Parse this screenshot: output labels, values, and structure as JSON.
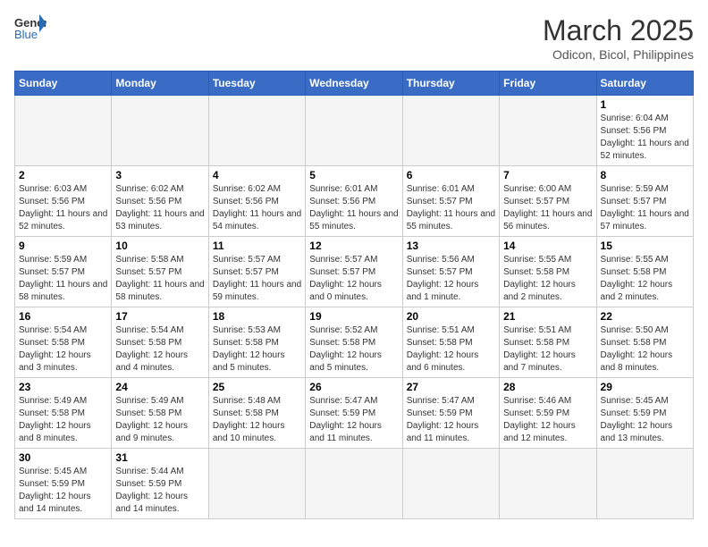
{
  "header": {
    "logo_general": "General",
    "logo_blue": "Blue",
    "month_year": "March 2025",
    "location": "Odicon, Bicol, Philippines"
  },
  "weekdays": [
    "Sunday",
    "Monday",
    "Tuesday",
    "Wednesday",
    "Thursday",
    "Friday",
    "Saturday"
  ],
  "weeks": [
    [
      {
        "day": "",
        "empty": true
      },
      {
        "day": "",
        "empty": true
      },
      {
        "day": "",
        "empty": true
      },
      {
        "day": "",
        "empty": true
      },
      {
        "day": "",
        "empty": true
      },
      {
        "day": "",
        "empty": true
      },
      {
        "day": "1",
        "sunrise": "6:04 AM",
        "sunset": "5:56 PM",
        "daylight": "11 hours and 52 minutes."
      }
    ],
    [
      {
        "day": "2",
        "sunrise": "6:03 AM",
        "sunset": "5:56 PM",
        "daylight": "11 hours and 52 minutes."
      },
      {
        "day": "3",
        "sunrise": "6:02 AM",
        "sunset": "5:56 PM",
        "daylight": "11 hours and 53 minutes."
      },
      {
        "day": "4",
        "sunrise": "6:02 AM",
        "sunset": "5:56 PM",
        "daylight": "11 hours and 54 minutes."
      },
      {
        "day": "5",
        "sunrise": "6:01 AM",
        "sunset": "5:56 PM",
        "daylight": "11 hours and 55 minutes."
      },
      {
        "day": "6",
        "sunrise": "6:01 AM",
        "sunset": "5:57 PM",
        "daylight": "11 hours and 55 minutes."
      },
      {
        "day": "7",
        "sunrise": "6:00 AM",
        "sunset": "5:57 PM",
        "daylight": "11 hours and 56 minutes."
      },
      {
        "day": "8",
        "sunrise": "5:59 AM",
        "sunset": "5:57 PM",
        "daylight": "11 hours and 57 minutes."
      }
    ],
    [
      {
        "day": "9",
        "sunrise": "5:59 AM",
        "sunset": "5:57 PM",
        "daylight": "11 hours and 58 minutes."
      },
      {
        "day": "10",
        "sunrise": "5:58 AM",
        "sunset": "5:57 PM",
        "daylight": "11 hours and 58 minutes."
      },
      {
        "day": "11",
        "sunrise": "5:57 AM",
        "sunset": "5:57 PM",
        "daylight": "11 hours and 59 minutes."
      },
      {
        "day": "12",
        "sunrise": "5:57 AM",
        "sunset": "5:57 PM",
        "daylight": "12 hours and 0 minutes."
      },
      {
        "day": "13",
        "sunrise": "5:56 AM",
        "sunset": "5:57 PM",
        "daylight": "12 hours and 1 minute."
      },
      {
        "day": "14",
        "sunrise": "5:55 AM",
        "sunset": "5:58 PM",
        "daylight": "12 hours and 2 minutes."
      },
      {
        "day": "15",
        "sunrise": "5:55 AM",
        "sunset": "5:58 PM",
        "daylight": "12 hours and 2 minutes."
      }
    ],
    [
      {
        "day": "16",
        "sunrise": "5:54 AM",
        "sunset": "5:58 PM",
        "daylight": "12 hours and 3 minutes."
      },
      {
        "day": "17",
        "sunrise": "5:54 AM",
        "sunset": "5:58 PM",
        "daylight": "12 hours and 4 minutes."
      },
      {
        "day": "18",
        "sunrise": "5:53 AM",
        "sunset": "5:58 PM",
        "daylight": "12 hours and 5 minutes."
      },
      {
        "day": "19",
        "sunrise": "5:52 AM",
        "sunset": "5:58 PM",
        "daylight": "12 hours and 5 minutes."
      },
      {
        "day": "20",
        "sunrise": "5:51 AM",
        "sunset": "5:58 PM",
        "daylight": "12 hours and 6 minutes."
      },
      {
        "day": "21",
        "sunrise": "5:51 AM",
        "sunset": "5:58 PM",
        "daylight": "12 hours and 7 minutes."
      },
      {
        "day": "22",
        "sunrise": "5:50 AM",
        "sunset": "5:58 PM",
        "daylight": "12 hours and 8 minutes."
      }
    ],
    [
      {
        "day": "23",
        "sunrise": "5:49 AM",
        "sunset": "5:58 PM",
        "daylight": "12 hours and 8 minutes."
      },
      {
        "day": "24",
        "sunrise": "5:49 AM",
        "sunset": "5:58 PM",
        "daylight": "12 hours and 9 minutes."
      },
      {
        "day": "25",
        "sunrise": "5:48 AM",
        "sunset": "5:58 PM",
        "daylight": "12 hours and 10 minutes."
      },
      {
        "day": "26",
        "sunrise": "5:47 AM",
        "sunset": "5:59 PM",
        "daylight": "12 hours and 11 minutes."
      },
      {
        "day": "27",
        "sunrise": "5:47 AM",
        "sunset": "5:59 PM",
        "daylight": "12 hours and 11 minutes."
      },
      {
        "day": "28",
        "sunrise": "5:46 AM",
        "sunset": "5:59 PM",
        "daylight": "12 hours and 12 minutes."
      },
      {
        "day": "29",
        "sunrise": "5:45 AM",
        "sunset": "5:59 PM",
        "daylight": "12 hours and 13 minutes."
      }
    ],
    [
      {
        "day": "30",
        "sunrise": "5:45 AM",
        "sunset": "5:59 PM",
        "daylight": "12 hours and 14 minutes."
      },
      {
        "day": "31",
        "sunrise": "5:44 AM",
        "sunset": "5:59 PM",
        "daylight": "12 hours and 14 minutes."
      },
      {
        "day": "",
        "empty": true
      },
      {
        "day": "",
        "empty": true
      },
      {
        "day": "",
        "empty": true
      },
      {
        "day": "",
        "empty": true
      },
      {
        "day": "",
        "empty": true
      }
    ]
  ]
}
